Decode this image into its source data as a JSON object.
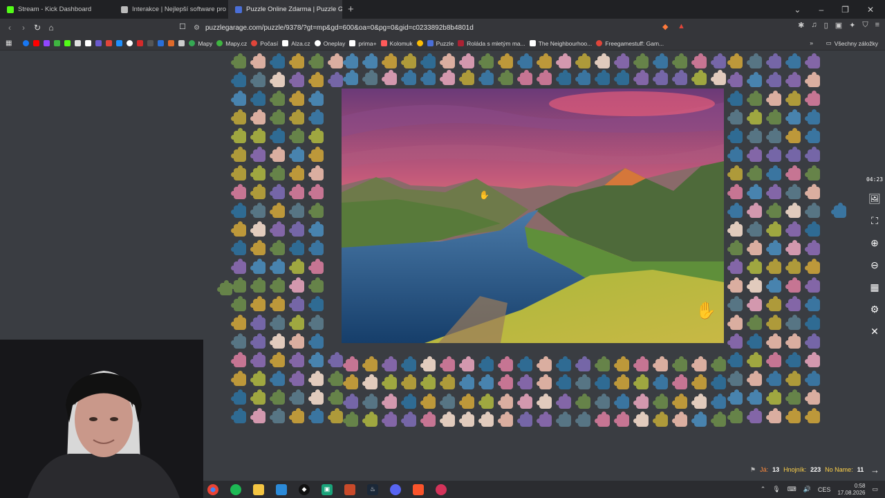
{
  "tabs": [
    {
      "title": "Stream - Kick Dashboard",
      "color": "#53fc18"
    },
    {
      "title": "Interakce | Nejlepší software pro",
      "color": "#cccccc"
    },
    {
      "title": "Puzzle Online Zdarma | Puzzle G",
      "color": "#4a6fd8",
      "active": true
    }
  ],
  "address": {
    "url": "puzzlegarage.com/puzzle/9378/?gt=mp&gd=600&oa=0&pg=0&gid=c0233892b8b4801d"
  },
  "bookmarks": {
    "items": [
      {
        "label": "",
        "color": "#1877f2"
      },
      {
        "label": "",
        "color": "#ff0000"
      },
      {
        "label": "",
        "color": "#9146ff"
      },
      {
        "label": "",
        "color": "#53fc18"
      },
      {
        "label": "",
        "color": "#e0e0e0"
      },
      {
        "label": "",
        "color": "#9b59b6"
      },
      {
        "label": "Mapy",
        "color": "#35a853"
      },
      {
        "label": "Mapy.cz",
        "color": "#3fb540"
      },
      {
        "label": "Počasí",
        "color": "#e0453a"
      },
      {
        "label": "Alza.cz",
        "color": "#ffffff"
      },
      {
        "label": "Oneplay",
        "color": "#ffffff"
      },
      {
        "label": "prima+",
        "color": "#ffffff"
      },
      {
        "label": "Kolomuk",
        "color": "#ff5a5a"
      },
      {
        "label": "Puzzle",
        "color": "#4a6fd8"
      },
      {
        "label": "Roláda s mletým ma...",
        "color": "#aa2233"
      },
      {
        "label": "The Neighbourhoo...",
        "color": "#ffffff"
      },
      {
        "label": "Freegamestuff: Gam...",
        "color": "#e0453a"
      }
    ],
    "all_label": "Všechny záložky"
  },
  "game": {
    "timer": "04:23",
    "players": [
      {
        "name": "Já:",
        "score": "13"
      },
      {
        "name": "Hnojník:",
        "score": "223"
      },
      {
        "name": "No Name:",
        "score": "11"
      }
    ],
    "side_icons": [
      "image-icon",
      "fullscreen-icon",
      "zoom-in-icon",
      "zoom-out-icon",
      "grid-icon",
      "settings-icon",
      "close-icon"
    ]
  },
  "taskbar": {
    "lang": "CES",
    "time": "0:58",
    "date": "17.08.2026"
  }
}
